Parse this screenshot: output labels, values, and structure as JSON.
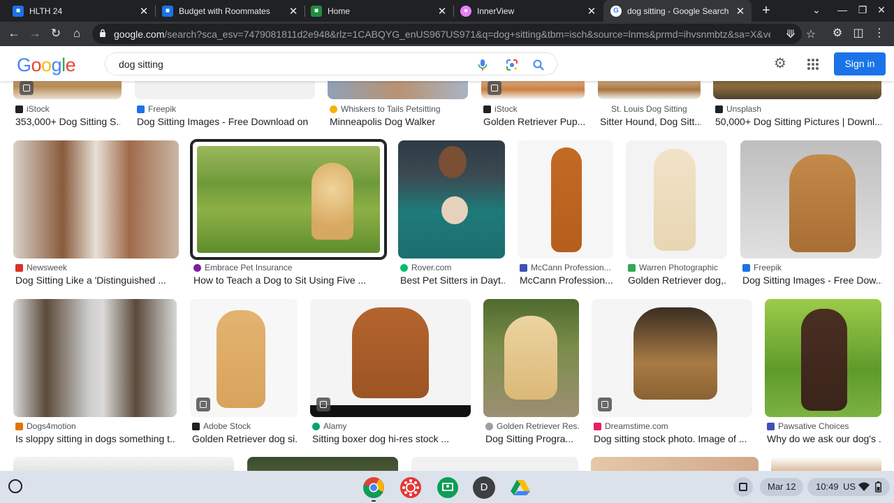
{
  "tabs": [
    {
      "title": "HLTH 24",
      "favicon": "classroom-icon",
      "color": "#1a73e8"
    },
    {
      "title": "Budget with Roommates",
      "favicon": "classroom-icon",
      "color": "#1a73e8"
    },
    {
      "title": "Home",
      "favicon": "classroom-home-icon",
      "color": "#1e8e3e"
    },
    {
      "title": "InnerView",
      "favicon": "innerview-icon",
      "color": "#ea80fc"
    },
    {
      "title": "dog sitting - Google Search",
      "favicon": "google-icon",
      "color": "#ffffff"
    }
  ],
  "omnibox": {
    "host": "google.com",
    "path": "/search?sca_esv=7479081811d2e948&rlz=1CABQYG_enUS967US971&q=dog+sitting&tbm=isch&source=lnms&prmd=ihvsnmbtz&sa=X&ved=2ahUK..."
  },
  "google": {
    "logo_letters": [
      {
        "ch": "G",
        "color": "#4285f4"
      },
      {
        "ch": "o",
        "color": "#ea4335"
      },
      {
        "ch": "o",
        "color": "#fbbc05"
      },
      {
        "ch": "g",
        "color": "#4285f4"
      },
      {
        "ch": "l",
        "color": "#34a853"
      },
      {
        "ch": "e",
        "color": "#ea4335"
      }
    ],
    "query": "dog sitting",
    "sign_in": "Sign in"
  },
  "results": {
    "row1": [
      {
        "source": "iStock",
        "title": "353,000+ Dog Sitting S...",
        "src_color": "#202124"
      },
      {
        "source": "Freepik",
        "title": "Dog Sitting Images - Free Download on ...",
        "src_color": "#1a73e8"
      },
      {
        "source": "Whiskers to Tails Petsitting",
        "title": "Minneapolis Dog Walker",
        "src_color": "#f4b400"
      },
      {
        "source": "iStock",
        "title": "Golden Retriever Pup...",
        "src_color": "#202124"
      },
      {
        "source": "St. Louis Dog Sitting",
        "title": "Sitter Hound, Dog Sitt...",
        "src_color": "#ffffff"
      },
      {
        "source": "Unsplash",
        "title": "50,000+ Dog Sitting Pictures | Downl...",
        "src_color": "#202124"
      }
    ],
    "row2": [
      {
        "source": "Newsweek",
        "title": "Dog Sitting Like a 'Distinguished ...",
        "src_color": "#d93025"
      },
      {
        "source": "Embrace Pet Insurance",
        "title": "How to Teach a Dog to Sit Using Five ...",
        "src_color": "#7b1fa2"
      },
      {
        "source": "Rover.com",
        "title": "Best Pet Sitters in Dayt...",
        "src_color": "#00bd70"
      },
      {
        "source": "McCann Profession...",
        "title": "McCann Profession...",
        "src_color": "#3f51b5"
      },
      {
        "source": "Warren Photographic",
        "title": "Golden Retriever dog,...",
        "src_color": "#34a853"
      },
      {
        "source": "Freepik",
        "title": "Dog Sitting Images - Free Dow...",
        "src_color": "#1a73e8"
      }
    ],
    "row3": [
      {
        "source": "Dogs4motion",
        "title": "Is sloppy sitting in dogs something t...",
        "src_color": "#e37400"
      },
      {
        "source": "Adobe Stock",
        "title": "Golden Retriever dog si...",
        "src_color": "#202124"
      },
      {
        "source": "Alamy",
        "title": "Sitting boxer dog hi-res stock ...",
        "src_color": "#00a36c"
      },
      {
        "source": "Golden Retriever Res...",
        "title": "Dog Sitting Progra...",
        "src_color": "#9e9e9e"
      },
      {
        "source": "Dreamstime.com",
        "title": "Dog sitting stock photo. Image of ...",
        "src_color": "#e91e63"
      },
      {
        "source": "Pawsative Choices",
        "title": "Why do we ask our dog's ...",
        "src_color": "#3f51b5"
      }
    ]
  },
  "shelf": {
    "apps": [
      {
        "name": "chrome-app-icon"
      },
      {
        "name": "canvas-app-icon",
        "color": "#e53935"
      },
      {
        "name": "classroom-app-icon",
        "color": "#0f9d58"
      },
      {
        "name": "account-app-icon",
        "letter": "D",
        "color": "#3c4043"
      },
      {
        "name": "drive-app-icon"
      }
    ],
    "date": "Mar 12",
    "time": "10:49",
    "locale": "US"
  }
}
